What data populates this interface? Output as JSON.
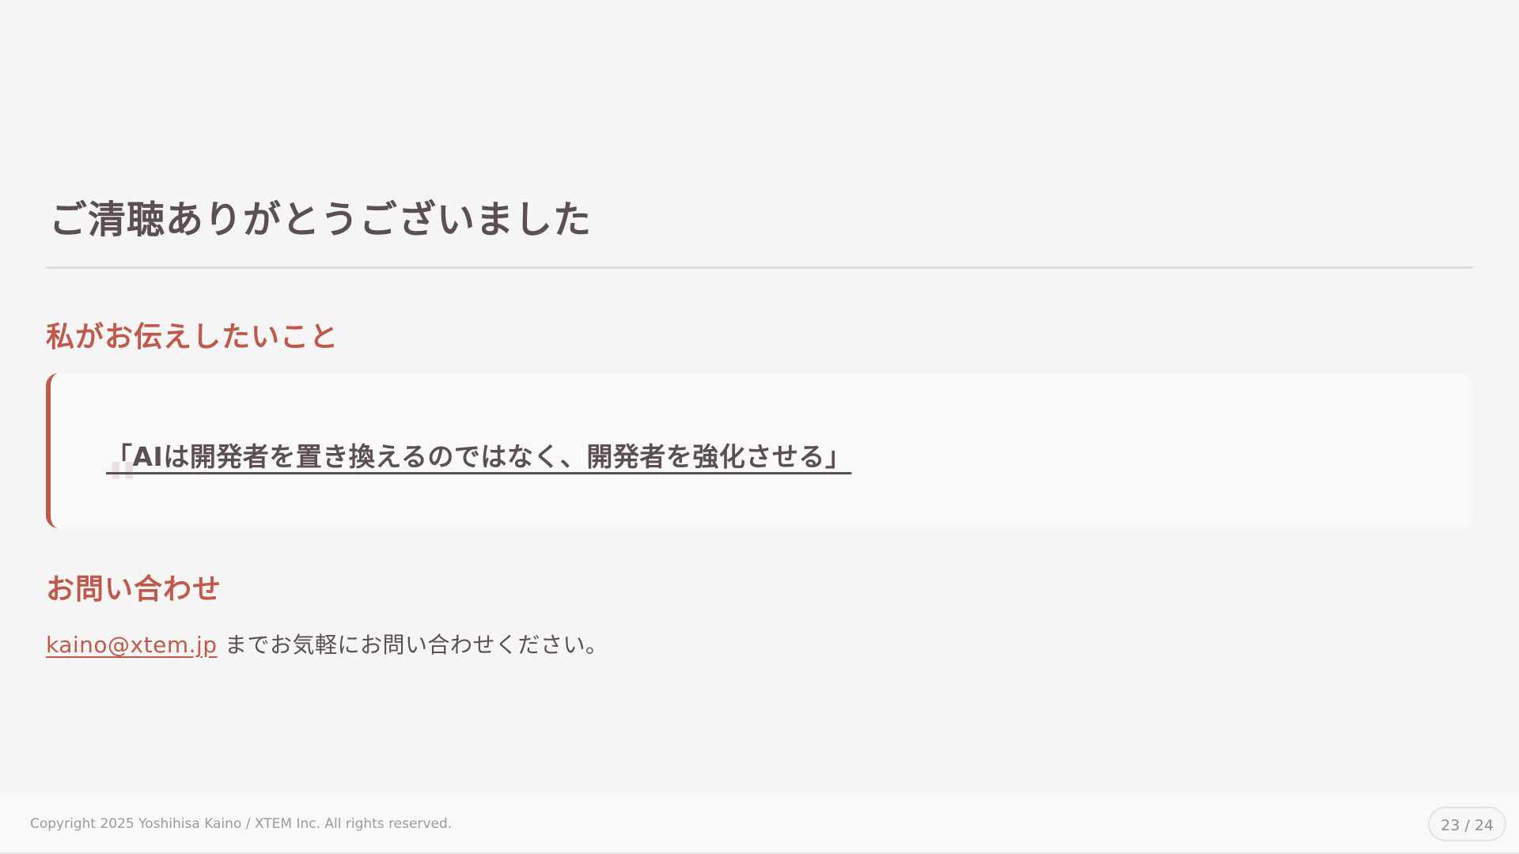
{
  "slide": {
    "title": "ご清聴ありがとうございました",
    "message_heading": "私がお伝えしたいこと",
    "quote_mark": "\"",
    "quote": "「AIは開発者を置き換えるのではなく、開発者を強化させる」",
    "contact_heading": "お問い合わせ",
    "contact_email": "kaino@xtem.jp",
    "contact_text": " までお気軽にお問い合わせください。"
  },
  "footer": {
    "copyright": "Copyright 2025 Yoshihisa Kaino / XTEM Inc. All rights reserved.",
    "page_counter": "23 / 24"
  },
  "colors": {
    "accent": "#c0594a",
    "text": "#5b4e55",
    "background": "#f5f5f5"
  }
}
